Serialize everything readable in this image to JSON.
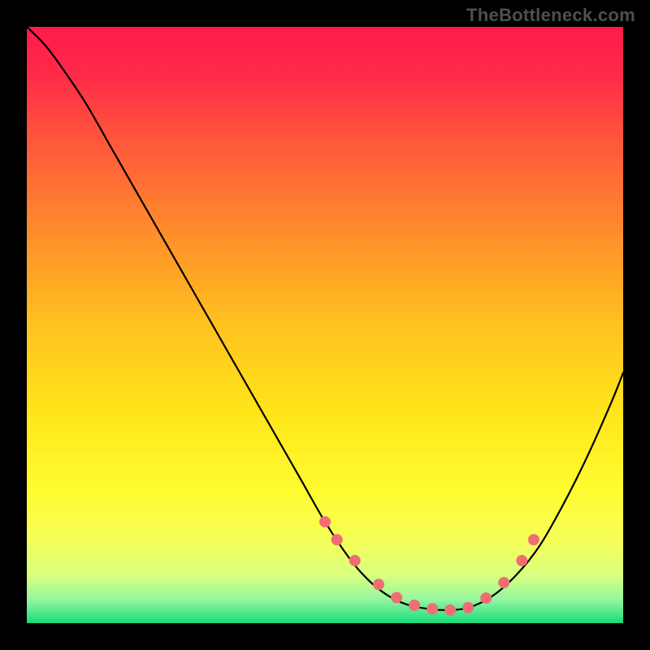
{
  "attribution": "TheBottleneck.com",
  "chart_data": {
    "type": "line",
    "title": "",
    "xlabel": "",
    "ylabel": "",
    "xlim": [
      0,
      100
    ],
    "ylim": [
      0,
      100
    ],
    "background_gradient": {
      "stops": [
        {
          "offset": 0.0,
          "color": "#ff1a4a"
        },
        {
          "offset": 0.08,
          "color": "#ff2a48"
        },
        {
          "offset": 0.2,
          "color": "#ff5a3a"
        },
        {
          "offset": 0.35,
          "color": "#ff8f2a"
        },
        {
          "offset": 0.5,
          "color": "#ffc21f"
        },
        {
          "offset": 0.65,
          "color": "#ffe61a"
        },
        {
          "offset": 0.78,
          "color": "#fffc30"
        },
        {
          "offset": 0.86,
          "color": "#f6ff57"
        },
        {
          "offset": 0.92,
          "color": "#d8ff80"
        },
        {
          "offset": 0.96,
          "color": "#95f7a0"
        },
        {
          "offset": 0.985,
          "color": "#46e68a"
        },
        {
          "offset": 1.0,
          "color": "#18d977"
        }
      ]
    },
    "series": [
      {
        "name": "bottleneck-curve",
        "color": "#000000",
        "stroke_width": 2.2,
        "x": [
          0,
          3,
          6,
          10,
          14,
          18,
          22,
          26,
          30,
          34,
          38,
          42,
          46,
          50,
          54,
          57,
          60,
          63,
          66,
          70,
          74,
          78,
          82,
          86,
          90,
          94,
          98,
          100
        ],
        "values": [
          100,
          97,
          93,
          87,
          80,
          73,
          66,
          59,
          52,
          45,
          38,
          31,
          24,
          17,
          11,
          7.5,
          5,
          3.4,
          2.6,
          2.2,
          2.6,
          4.5,
          8,
          13,
          20,
          28,
          37,
          42
        ]
      }
    ],
    "markers": {
      "name": "highlight-dots",
      "color": "#ef6e74",
      "radius": 7,
      "x": [
        50,
        52,
        55,
        59,
        62,
        65,
        68,
        71,
        74,
        77,
        80,
        83,
        85
      ],
      "values": [
        17,
        14,
        10.5,
        6.5,
        4.3,
        3.0,
        2.4,
        2.2,
        2.6,
        4.2,
        6.8,
        10.5,
        14
      ]
    }
  }
}
